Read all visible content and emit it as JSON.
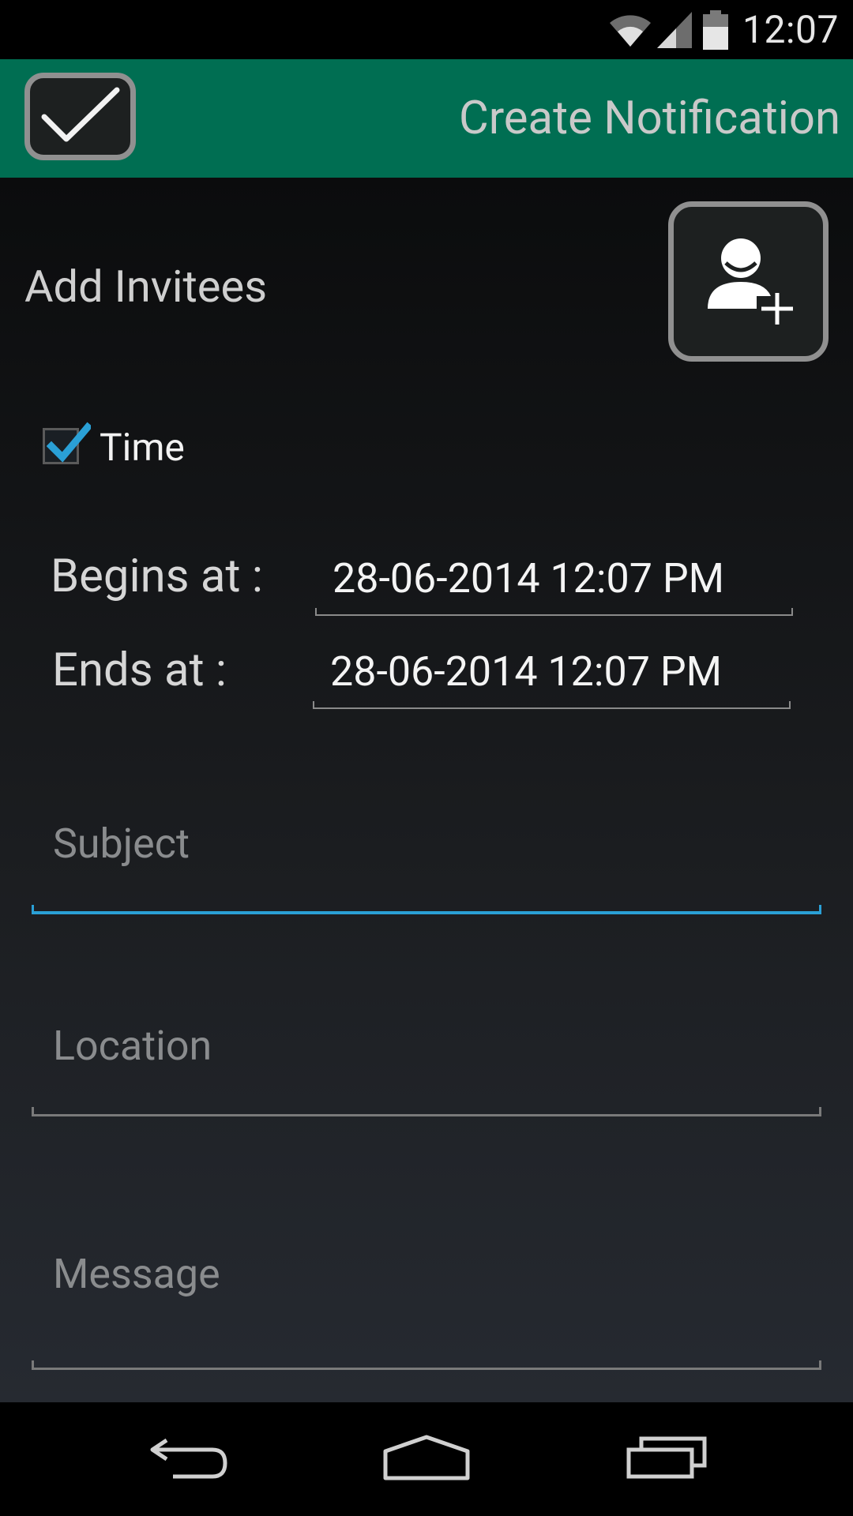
{
  "status_bar": {
    "time": "12:07",
    "icons": [
      "wifi-icon",
      "cell-signal-icon",
      "battery-icon"
    ]
  },
  "action_bar": {
    "title": "Create Notification",
    "done_icon": "checkmark-icon",
    "background": "#006e52"
  },
  "invitees": {
    "label": "Add Invitees",
    "button_icon": "add-person-icon"
  },
  "time_option": {
    "label": "Time",
    "checked": true
  },
  "schedule": {
    "begins_label": "Begins at :",
    "begins_value": "28-06-2014 12:07 PM",
    "ends_label": "Ends at :",
    "ends_value": "28-06-2014 12:07 PM"
  },
  "fields": {
    "subject_placeholder": "Subject",
    "location_placeholder": "Location",
    "message_placeholder": "Message"
  },
  "nav_bar": {
    "icons": [
      "back-icon",
      "home-icon",
      "recents-icon"
    ]
  },
  "colors": {
    "accent": "#2aa0d6",
    "action_bar": "#006e52"
  }
}
